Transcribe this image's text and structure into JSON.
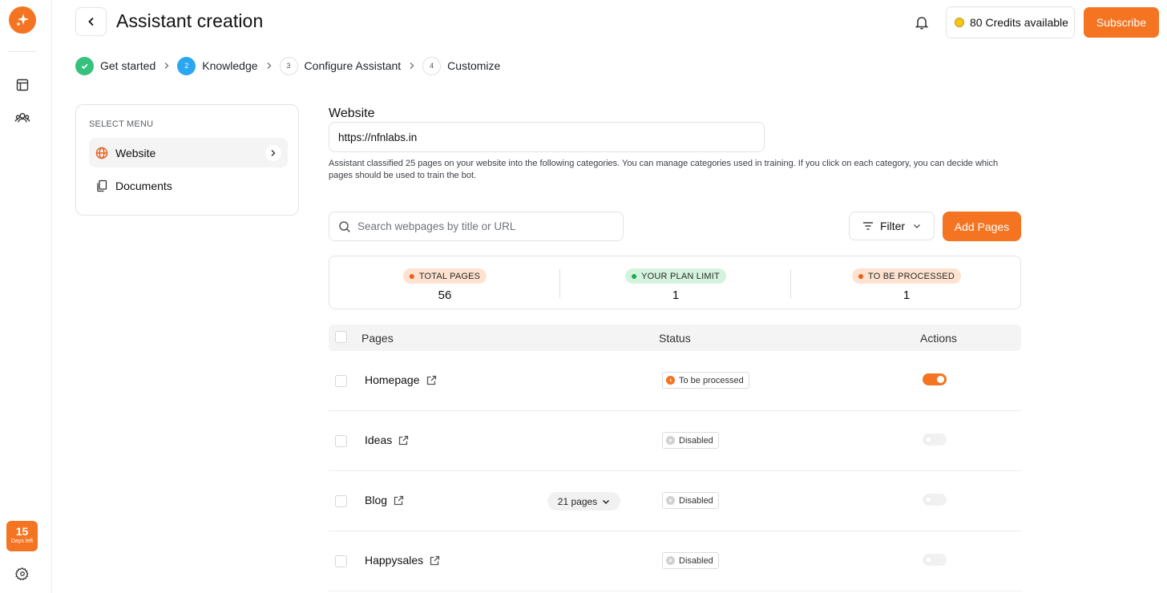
{
  "header": {
    "title": "Assistant creation",
    "credits": "80 Credits available",
    "subscribe": "Subscribe"
  },
  "rail": {
    "days_number": "15",
    "days_label": "Days left"
  },
  "stepper": [
    {
      "number": "",
      "label": "Get started",
      "state": "done"
    },
    {
      "number": "2",
      "label": "Knowledge",
      "state": "active"
    },
    {
      "number": "3",
      "label": "Configure Assistant",
      "state": "todo"
    },
    {
      "number": "4",
      "label": "Customize",
      "state": "todo"
    }
  ],
  "menu": {
    "heading": "SELECT MENU",
    "items": [
      {
        "label": "Website",
        "icon": "globe-icon"
      },
      {
        "label": "Documents",
        "icon": "documents-icon"
      }
    ]
  },
  "website": {
    "title": "Website",
    "url": "https://nfnlabs.in",
    "description": "Assistant classified 25 pages on your website into the following categories. You can manage categories used in training. If you click on each category, you can decide which pages should be used to train the bot."
  },
  "search": {
    "placeholder": "Search webpages by title or URL"
  },
  "toolbar": {
    "filter": "Filter",
    "add_pages": "Add Pages"
  },
  "stats": [
    {
      "label": "TOTAL PAGES",
      "value": "56",
      "color": "#e8601c"
    },
    {
      "label": "YOUR PLAN LIMIT",
      "value": "1",
      "color": "#1fa84f"
    },
    {
      "label": "TO BE PROCESSED",
      "value": "1",
      "color": "#e8601c"
    }
  ],
  "table": {
    "headers": [
      "Pages",
      "Status",
      "Actions"
    ],
    "rows": [
      {
        "name": "Homepage",
        "pages": "",
        "status": "To be processed",
        "enabled": true
      },
      {
        "name": "Ideas",
        "pages": "",
        "status": "Disabled",
        "enabled": false
      },
      {
        "name": "Blog",
        "pages": "21 pages",
        "status": "Disabled",
        "enabled": false
      },
      {
        "name": "Happysales",
        "pages": "",
        "status": "Disabled",
        "enabled": false
      }
    ]
  },
  "colors": {
    "accent": "#f47421",
    "step_done": "#35c27d",
    "step_active": "#2aa7f0"
  }
}
